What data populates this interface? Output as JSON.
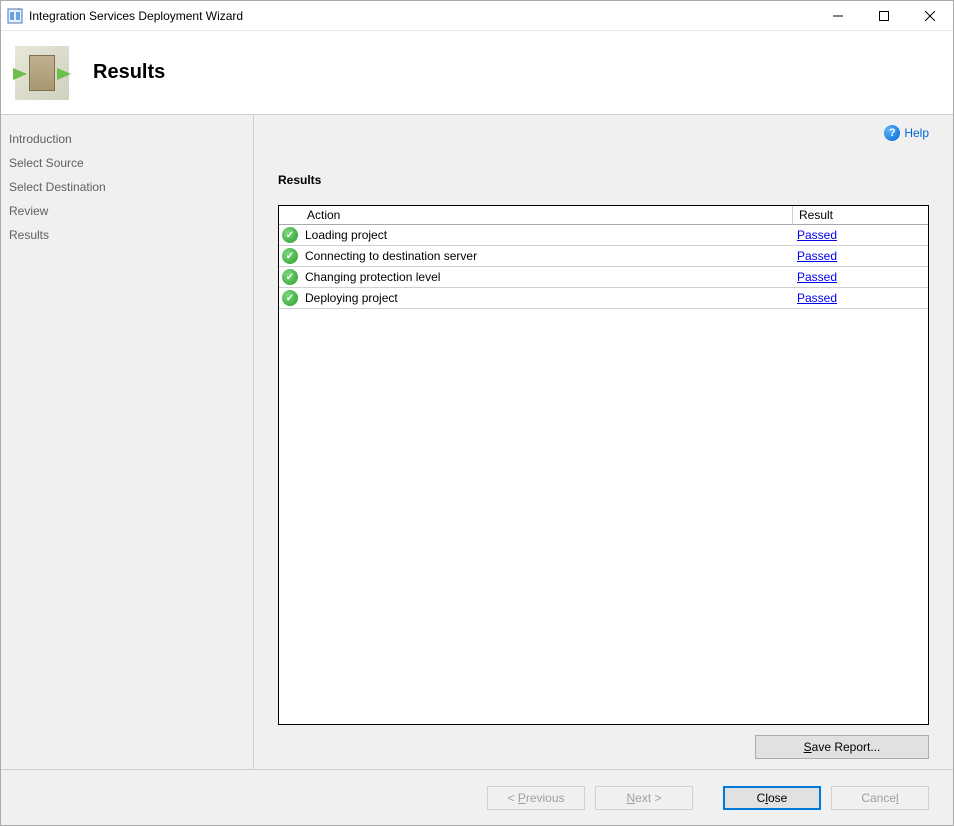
{
  "titlebar": {
    "title": "Integration Services Deployment Wizard"
  },
  "header": {
    "title": "Results"
  },
  "sidebar": {
    "items": [
      {
        "label": "Introduction"
      },
      {
        "label": "Select Source"
      },
      {
        "label": "Select Destination"
      },
      {
        "label": "Review"
      },
      {
        "label": "Results"
      }
    ]
  },
  "content": {
    "help_label": "Help",
    "section_title": "Results",
    "columns": {
      "action": "Action",
      "result": "Result"
    },
    "rows": [
      {
        "action": "Loading project",
        "result": "Passed"
      },
      {
        "action": "Connecting to destination server",
        "result": "Passed"
      },
      {
        "action": "Changing protection level",
        "result": "Passed"
      },
      {
        "action": "Deploying project",
        "result": "Passed"
      }
    ],
    "save_report_label": "Save Report..."
  },
  "footer": {
    "previous": "< Previous",
    "next": "Next >",
    "close": "Close",
    "cancel": "Cancel"
  }
}
